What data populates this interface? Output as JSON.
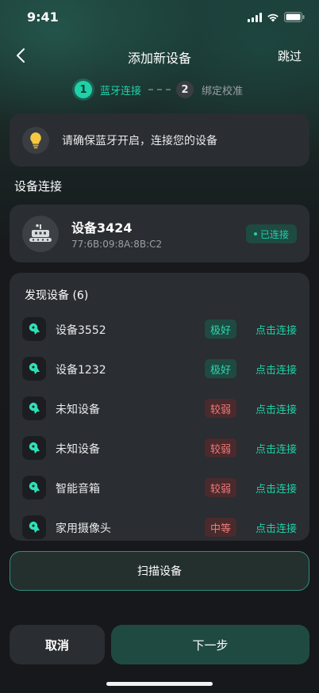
{
  "status_bar": {
    "time": "9:41"
  },
  "navbar": {
    "title": "添加新设备",
    "skip_label": "跳过"
  },
  "steps": [
    {
      "number": "1",
      "label": "蓝牙连接"
    },
    {
      "number": "2",
      "label": "绑定校准"
    }
  ],
  "tip": {
    "text": "请确保蓝牙开启，连接您的设备"
  },
  "connection_section": {
    "title": "设备连接"
  },
  "connected_device": {
    "name": "设备3424",
    "mac": "77:6B:09:8A:8B:C2",
    "status": "已连接"
  },
  "found_devices": {
    "header": "发现设备 (6)",
    "items": [
      {
        "name": "设备3552",
        "signal": "极好",
        "action": "点击连接"
      },
      {
        "name": "设备1232",
        "signal": "极好",
        "action": "点击连接"
      },
      {
        "name": "未知设备",
        "signal": "较弱",
        "action": "点击连接"
      },
      {
        "name": "未知设备",
        "signal": "较弱",
        "action": "点击连接"
      },
      {
        "name": "智能音箱",
        "signal": "较弱",
        "action": "点击连接"
      },
      {
        "name": "家用摄像头",
        "signal": "中等",
        "action": "点击连接"
      }
    ]
  },
  "buttons": {
    "scan": "扫描设备",
    "cancel": "取消",
    "next": "下一步"
  },
  "colors": {
    "accent": "#1fd1a9",
    "weak": "#f07b7b",
    "card": "#2a2d31"
  }
}
